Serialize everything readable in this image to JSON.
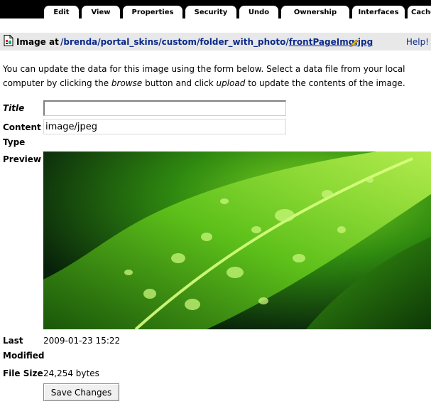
{
  "tabs": [
    {
      "label": "Edit"
    },
    {
      "label": "View"
    },
    {
      "label": "Properties"
    },
    {
      "label": "Security"
    },
    {
      "label": "Undo"
    },
    {
      "label": "Ownership"
    },
    {
      "label": "Interfaces"
    },
    {
      "label": "Cache"
    }
  ],
  "header": {
    "label": "Image at",
    "path": [
      {
        "text": "/brenda"
      },
      {
        "text": "/portal_skins"
      },
      {
        "text": "/custom"
      },
      {
        "text": "/folder_with_photo"
      },
      {
        "text": "/"
      },
      {
        "text": "frontPageImg.jpg"
      }
    ],
    "help": "Help!"
  },
  "intro": {
    "part1": "You can update the data for this image using the form below. Select a data file from your local computer by clicking the ",
    "em1": "browse",
    "part2": " button and click ",
    "em2": "upload",
    "part3": " to update the contents of the image."
  },
  "form": {
    "title_label": "Title",
    "title_value": "",
    "content_type_label_1": "Content",
    "content_type_label_2": "Type",
    "content_type_value": "image/jpeg",
    "preview_label": "Preview",
    "last_modified_label_1": "Last",
    "last_modified_label_2": "Modified",
    "last_modified_value": "2009-01-23 15:22",
    "file_size_label": "File Size",
    "file_size_value": "24,254 bytes",
    "save_button": "Save Changes"
  },
  "colors": {
    "link": "#0b2a8a",
    "header_bg": "#e8e8e8",
    "tabbar_bg": "#000000"
  }
}
